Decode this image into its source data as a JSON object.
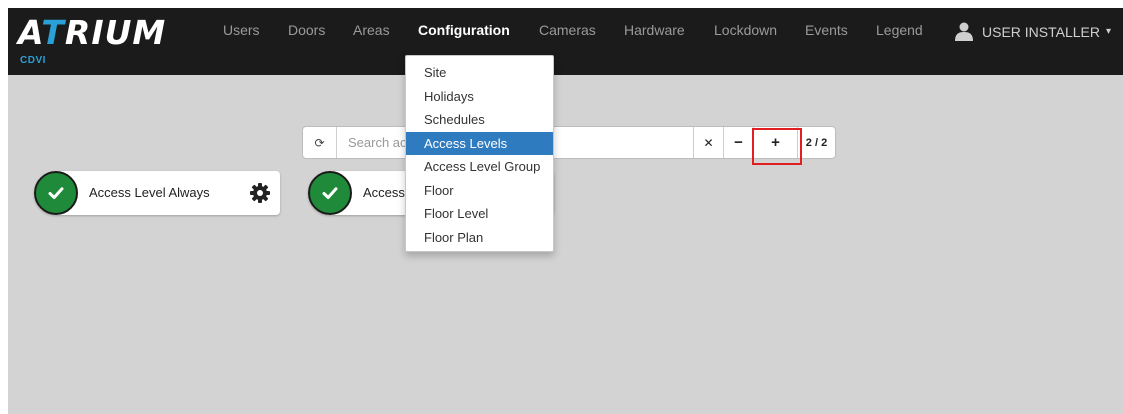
{
  "brand": {
    "logo_prefix": "A",
    "logo_accent": "T",
    "logo_suffix": "RIUM",
    "sub": "CDVI"
  },
  "nav": {
    "items": [
      {
        "label": "Users"
      },
      {
        "label": "Doors"
      },
      {
        "label": "Areas"
      },
      {
        "label": "Configuration"
      },
      {
        "label": "Cameras"
      },
      {
        "label": "Hardware"
      },
      {
        "label": "Lockdown"
      },
      {
        "label": "Events"
      },
      {
        "label": "Legend"
      }
    ],
    "active_label": "Configuration",
    "user": {
      "name": "USER INSTALLER",
      "caret": "▾"
    }
  },
  "dropdown": {
    "items": [
      {
        "label": "Site"
      },
      {
        "label": "Holidays"
      },
      {
        "label": "Schedules"
      },
      {
        "label": "Access Levels"
      },
      {
        "label": "Access Level Group"
      },
      {
        "label": "Floor"
      },
      {
        "label": "Floor Level"
      },
      {
        "label": "Floor Plan"
      }
    ],
    "active_label": "Access Levels"
  },
  "searchbar": {
    "refresh_glyph": "⟳",
    "placeholder": "Search ac",
    "clear_glyph": "✕",
    "minus_glyph": "−",
    "plus_glyph": "+",
    "count": "2 / 2"
  },
  "cards": [
    {
      "label": "Access Level Always",
      "icon": "check-circle-icon",
      "action_icon": "gear-icon"
    },
    {
      "label": "Access",
      "icon": "check-circle-icon"
    }
  ],
  "colors": {
    "navbar_bg": "#1b1b1b",
    "brand_accent": "#2aa0d8",
    "dropdown_active": "#2f7bbf",
    "card_status": "#1f8a3a",
    "highlight": "#e02020",
    "page_bg": "#d3d3d3"
  }
}
